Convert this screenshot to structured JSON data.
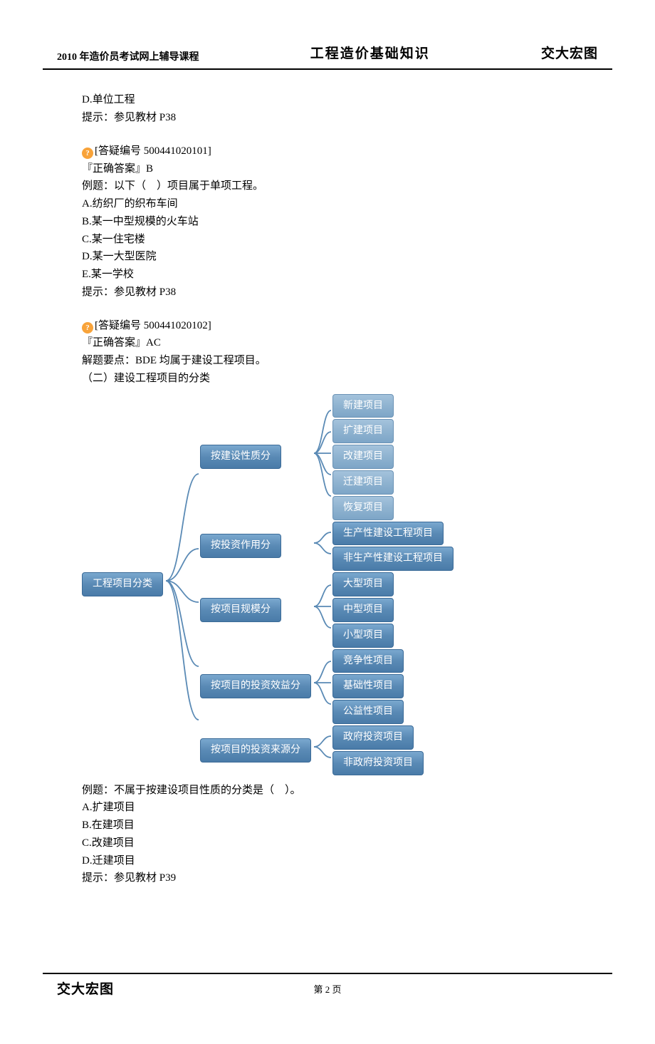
{
  "header": {
    "left": "2010 年造价员考试网上辅导课程",
    "center": "工程造价基础知识",
    "right": "交大宏图"
  },
  "body": {
    "q1": {
      "optD": "D.单位工程",
      "hint": "提示：参见教材 P38",
      "qid": "[答疑编号 500441020101]",
      "ans": "『正确答案』B"
    },
    "q2": {
      "stem": "例题：以下（　）项目属于单项工程。",
      "optA": "A.纺织厂的织布车间",
      "optB": "B.某一中型规模的火车站",
      "optC": "C.某一住宅楼",
      "optD": "D.某一大型医院",
      "optE": "E.某一学校",
      "hint": "提示：参见教材 P38",
      "qid": "[答疑编号 500441020102]",
      "ans": "『正确答案』AC",
      "expl": "解题要点：BDE 均属于建设工程项目。"
    },
    "sec": "（二）建设工程项目的分类",
    "q3": {
      "stem": "例题：不属于按建设项目性质的分类是（　）。",
      "optA": "A.扩建项目",
      "optB": "B.在建项目",
      "optC": "C.改建项目",
      "optD": "D.迁建项目",
      "hint": "提示：参见教材 P39"
    }
  },
  "chart_data": {
    "type": "tree",
    "root": "工程项目分类",
    "branches": [
      {
        "label": "按建设性质分",
        "children": [
          "新建项目",
          "扩建项目",
          "改建项目",
          "迁建项目",
          "恢复项目"
        ]
      },
      {
        "label": "按投资作用分",
        "children": [
          "生产性建设工程项目",
          "非生产性建设工程项目"
        ]
      },
      {
        "label": "按项目规模分",
        "children": [
          "大型项目",
          "中型项目",
          "小型项目"
        ]
      },
      {
        "label": "按项目的投资效益分",
        "children": [
          "竞争性项目",
          "基础性项目",
          "公益性项目"
        ]
      },
      {
        "label": "按项目的投资来源分",
        "children": [
          "政府投资项目",
          "非政府投资项目"
        ]
      }
    ]
  },
  "footer": {
    "left": "交大宏图",
    "center": "第 2 页"
  }
}
